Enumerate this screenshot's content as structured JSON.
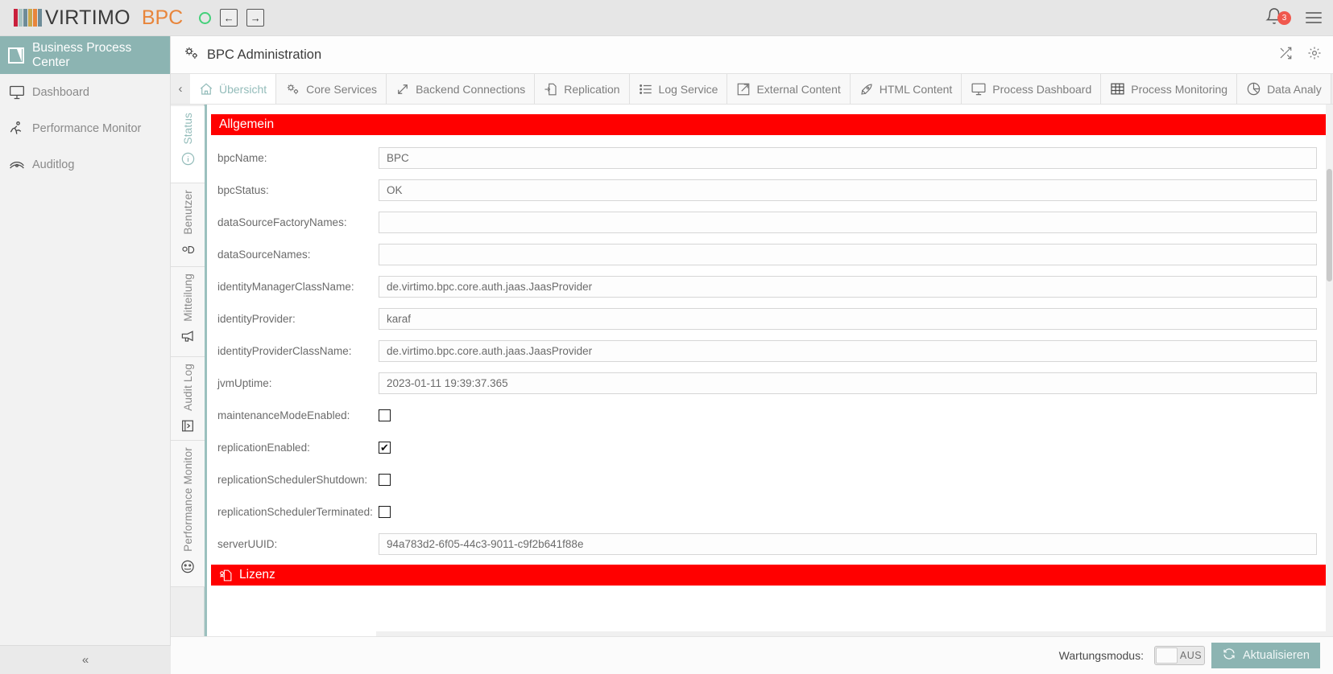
{
  "topbar": {
    "brand": "VIRTIMO",
    "product": "BPC",
    "status_color": "#44d07a",
    "back_label": "←",
    "forward_label": "→",
    "notification_count": "3",
    "icons": {
      "bell": "bell-icon",
      "menu": "hamburger-menu-icon"
    }
  },
  "sidebar": {
    "header_title": "Business Process Center",
    "header_color": "#8cb4b2",
    "items": [
      {
        "label": "Dashboard",
        "icon": "monitor-icon"
      },
      {
        "label": "Performance Monitor",
        "icon": "runner-icon"
      },
      {
        "label": "Auditlog",
        "icon": "eye-layers-icon"
      }
    ],
    "collapse_label": "«"
  },
  "main": {
    "title": "BPC Administration",
    "title_icon": "gears-icon",
    "header_actions": [
      {
        "name": "shuffle-icon"
      },
      {
        "name": "gear-icon"
      }
    ]
  },
  "tabstrip": {
    "scroll_left": "‹",
    "scroll_right": "›",
    "tabs": [
      {
        "label": "Übersicht",
        "icon": "home-icon",
        "active": true
      },
      {
        "label": "Core Services",
        "icon": "gears-icon",
        "active": false
      },
      {
        "label": "Backend Connections",
        "icon": "diagonal-arrows-icon",
        "active": false
      },
      {
        "label": "Replication",
        "icon": "file-arrow-icon",
        "active": false
      },
      {
        "label": "Log Service",
        "icon": "list-icon",
        "active": false
      },
      {
        "label": "External Content",
        "icon": "external-link-icon",
        "active": false
      },
      {
        "label": "HTML Content",
        "icon": "pen-icon",
        "active": false
      },
      {
        "label": "Process Dashboard",
        "icon": "monitor-icon",
        "active": false
      },
      {
        "label": "Process Monitoring",
        "icon": "table-grid-icon",
        "active": false
      },
      {
        "label": "Data Analy",
        "icon": "pie-chart-icon",
        "active": false
      }
    ]
  },
  "vtabs": [
    {
      "label": "Status",
      "icon": "info-circle-icon",
      "active": true
    },
    {
      "label": "Benutzer",
      "icon": "user-icon",
      "active": false
    },
    {
      "label": "Mitteilung",
      "icon": "megaphone-icon",
      "active": false
    },
    {
      "label": "Audit Log",
      "icon": "audit-book-icon",
      "active": false
    },
    {
      "label": "Performance Monitor",
      "icon": "gauge-icon",
      "active": false
    }
  ],
  "sections": [
    {
      "title": "Allgemein",
      "icon": null,
      "color": "#ff0000"
    },
    {
      "title": "Lizenz",
      "icon": "certificate-icon",
      "color": "#ff0000"
    }
  ],
  "form": {
    "rows": [
      {
        "label": "bpcName:",
        "type": "text",
        "value": "BPC"
      },
      {
        "label": "bpcStatus:",
        "type": "text",
        "value": "OK"
      },
      {
        "label": "dataSourceFactoryNames:",
        "type": "text",
        "value": ""
      },
      {
        "label": "dataSourceNames:",
        "type": "text",
        "value": ""
      },
      {
        "label": "identityManagerClassName:",
        "type": "text",
        "value": "de.virtimo.bpc.core.auth.jaas.JaasProvider"
      },
      {
        "label": "identityProvider:",
        "type": "text",
        "value": "karaf"
      },
      {
        "label": "identityProviderClassName:",
        "type": "text",
        "value": "de.virtimo.bpc.core.auth.jaas.JaasProvider"
      },
      {
        "label": "jvmUptime:",
        "type": "text",
        "value": "2023-01-11 19:39:37.365"
      },
      {
        "label": "maintenanceModeEnabled:",
        "type": "checkbox",
        "checked": false
      },
      {
        "label": "replicationEnabled:",
        "type": "checkbox",
        "checked": true
      },
      {
        "label": "replicationSchedulerShutdown:",
        "type": "checkbox",
        "checked": false
      },
      {
        "label": "replicationSchedulerTerminated:",
        "type": "checkbox",
        "checked": false
      },
      {
        "label": "serverUUID:",
        "type": "text",
        "value": "94a783d2-6f05-44c3-9011-c9f2b641f88e"
      }
    ]
  },
  "bottombar": {
    "maintenance_label": "Wartungsmodus:",
    "toggle_state": "AUS",
    "refresh_label": "Aktualisieren",
    "refresh_icon": "refresh-icon",
    "refresh_color": "#8cb4b2"
  }
}
